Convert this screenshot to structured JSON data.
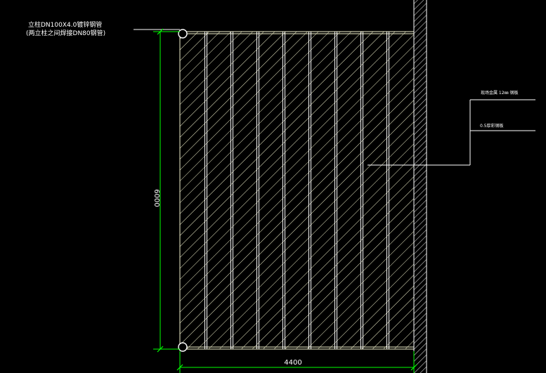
{
  "drawing": {
    "note_line1": "立柱DN100X4.0镀锌钢管",
    "note_line2": "(两立柱之间焊接DN80钢管)",
    "right_note_top": "现场金属 12㎜ 钢板",
    "right_note_bottom": "0.5厚彩钢板",
    "dim_height": "6000",
    "dim_width": "4400",
    "panel_count": 9
  },
  "colors": {
    "background": "#000000",
    "outline": "#ffffff",
    "hatch": "#f2f2cc",
    "dimension": "#00ff00",
    "wall": "#cfcfcf"
  }
}
